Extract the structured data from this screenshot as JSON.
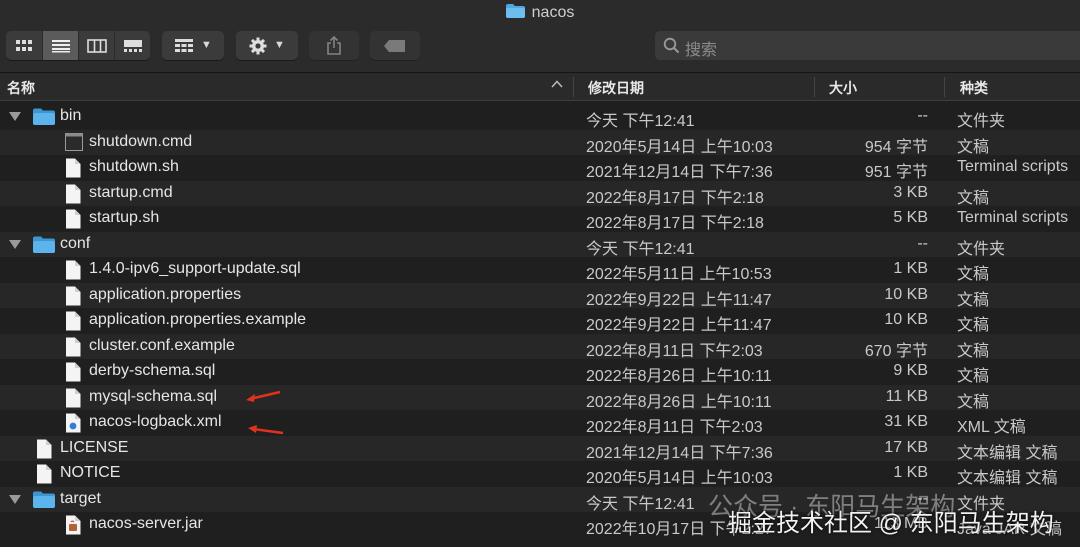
{
  "window": {
    "title": "nacos"
  },
  "toolbar": {
    "view_buttons": [
      {
        "name": "icon-view-button",
        "icon": "grid-icon",
        "active": false
      },
      {
        "name": "list-view-button",
        "icon": "list-icon",
        "active": true
      },
      {
        "name": "column-view-button",
        "icon": "columns-icon",
        "active": false
      },
      {
        "name": "gallery-view-button",
        "icon": "gallery-icon",
        "active": false
      }
    ],
    "group_icon": "group-by-icon",
    "action_icon": "gear-icon",
    "share_icon": "share-icon",
    "tag_icon": "tag-icon"
  },
  "search": {
    "placeholder": "搜索"
  },
  "columns": {
    "name": "名称",
    "date": "修改日期",
    "size": "大小",
    "kind": "种类"
  },
  "rows": [
    {
      "indent": 0,
      "folder": true,
      "name": "bin",
      "date": "今天 下午12:41",
      "size": "--",
      "kind": "文件夹",
      "icon": "folder-icon"
    },
    {
      "indent": 1,
      "folder": false,
      "name": "shutdown.cmd",
      "date": "2020年5月14日 上午10:03",
      "size": "954 字节",
      "kind": "文稿",
      "icon": "terminal-doc-icon"
    },
    {
      "indent": 1,
      "folder": false,
      "name": "shutdown.sh",
      "date": "2021年12月14日 下午7:36",
      "size": "951 字节",
      "kind": "Terminal scripts",
      "icon": "document-icon"
    },
    {
      "indent": 1,
      "folder": false,
      "name": "startup.cmd",
      "date": "2022年8月17日 下午2:18",
      "size": "3 KB",
      "kind": "文稿",
      "icon": "document-icon"
    },
    {
      "indent": 1,
      "folder": false,
      "name": "startup.sh",
      "date": "2022年8月17日 下午2:18",
      "size": "5 KB",
      "kind": "Terminal scripts",
      "icon": "document-icon"
    },
    {
      "indent": 0,
      "folder": true,
      "name": "conf",
      "date": "今天 下午12:41",
      "size": "--",
      "kind": "文件夹",
      "icon": "folder-icon"
    },
    {
      "indent": 1,
      "folder": false,
      "name": "1.4.0-ipv6_support-update.sql",
      "date": "2022年5月11日 上午10:53",
      "size": "1 KB",
      "kind": "文稿",
      "icon": "document-icon"
    },
    {
      "indent": 1,
      "folder": false,
      "name": "application.properties",
      "date": "2022年9月22日 上午11:47",
      "size": "10 KB",
      "kind": "文稿",
      "icon": "document-icon"
    },
    {
      "indent": 1,
      "folder": false,
      "name": "application.properties.example",
      "date": "2022年9月22日 上午11:47",
      "size": "10 KB",
      "kind": "文稿",
      "icon": "document-icon"
    },
    {
      "indent": 1,
      "folder": false,
      "name": "cluster.conf.example",
      "date": "2022年8月11日 下午2:03",
      "size": "670 字节",
      "kind": "文稿",
      "icon": "document-icon"
    },
    {
      "indent": 1,
      "folder": false,
      "name": "derby-schema.sql",
      "date": "2022年8月26日 上午10:11",
      "size": "9 KB",
      "kind": "文稿",
      "icon": "document-icon"
    },
    {
      "indent": 1,
      "folder": false,
      "name": "mysql-schema.sql",
      "date": "2022年8月26日 上午10:11",
      "size": "11 KB",
      "kind": "文稿",
      "icon": "document-icon"
    },
    {
      "indent": 1,
      "folder": false,
      "name": "nacos-logback.xml",
      "date": "2022年8月11日 下午2:03",
      "size": "31 KB",
      "kind": "XML 文稿",
      "icon": "xml-doc-icon"
    },
    {
      "indent": 0,
      "folder": false,
      "name": "LICENSE",
      "date": "2021年12月14日 下午7:36",
      "size": "17 KB",
      "kind": "文本编辑 文稿",
      "icon": "document-icon"
    },
    {
      "indent": 0,
      "folder": false,
      "name": "NOTICE",
      "date": "2020年5月14日 上午10:03",
      "size": "1 KB",
      "kind": "文本编辑 文稿",
      "icon": "document-icon"
    },
    {
      "indent": 0,
      "folder": true,
      "name": "target",
      "date": "今天 下午12:41",
      "size": "--",
      "kind": "文件夹",
      "icon": "folder-icon"
    },
    {
      "indent": 1,
      "folder": false,
      "name": "nacos-server.jar",
      "date": "2022年10月17日 下午2:27",
      "size": "113 MB",
      "kind": "Java JAR 文稿",
      "icon": "jar-icon"
    }
  ],
  "annotations": [
    {
      "points_to": "mysql-schema.sql",
      "color": "#e0321e"
    },
    {
      "points_to": "nacos-logback.xml",
      "color": "#e0321e"
    }
  ],
  "watermark": {
    "line1": "公众号 · 东阳马生架构",
    "line2": "掘金技术社区 @ 东阳马生架构"
  },
  "colors": {
    "folder": "#4fa8e0",
    "arrow": "#e0321e",
    "background": "#1f1f1f"
  }
}
